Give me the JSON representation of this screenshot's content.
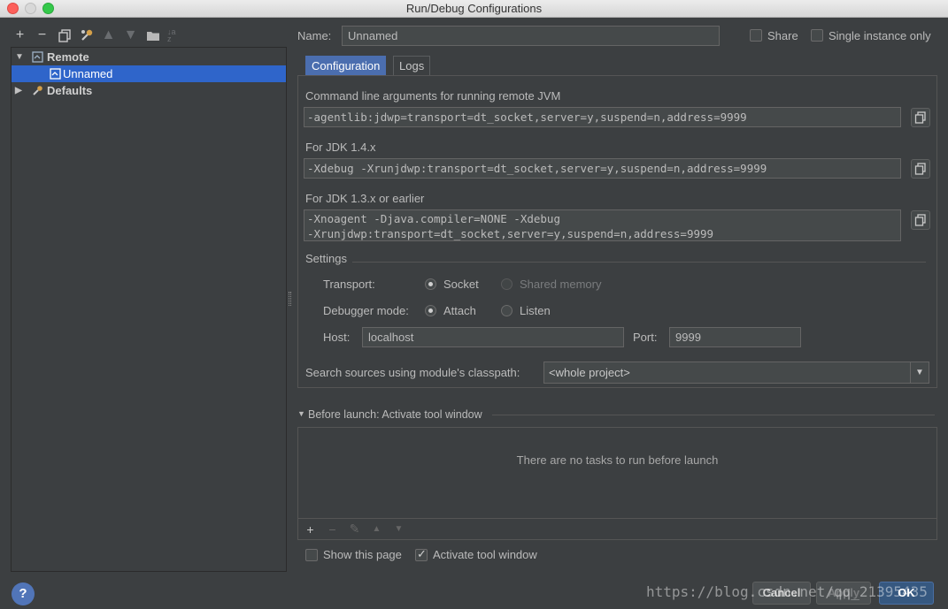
{
  "window": {
    "title": "Run/Debug Configurations"
  },
  "toolbar": {
    "icons": [
      "add-icon",
      "remove-icon",
      "copy-icon",
      "wrench-icon",
      "arrow-up-icon",
      "arrow-down-icon",
      "folder-icon",
      "sort-icon"
    ],
    "sort_glyph": "↓a z"
  },
  "tree": {
    "items": [
      {
        "label": "Remote",
        "expanded": true
      },
      {
        "label": "Unnamed",
        "selected": true
      },
      {
        "label": "Defaults",
        "expanded": false
      }
    ]
  },
  "header": {
    "name_label": "Name:",
    "name_value": "Unnamed",
    "share_label": "Share",
    "single_instance_label": "Single instance only"
  },
  "tabs": [
    {
      "label": "Configuration",
      "active": true
    },
    {
      "label": "Logs",
      "active": false
    }
  ],
  "config": {
    "cmd_label": "Command line arguments for running remote JVM",
    "cmd_value": "-agentlib:jdwp=transport=dt_socket,server=y,suspend=n,address=9999",
    "jdk14_label": "For JDK 1.4.x",
    "jdk14_value": "-Xdebug -Xrunjdwp:transport=dt_socket,server=y,suspend=n,address=9999",
    "jdk13_label": "For JDK 1.3.x or earlier",
    "jdk13_value": "-Xnoagent -Djava.compiler=NONE -Xdebug\n-Xrunjdwp:transport=dt_socket,server=y,suspend=n,address=9999",
    "settings_label": "Settings",
    "transport_label": "Transport:",
    "transport_options": [
      "Socket",
      "Shared memory"
    ],
    "debugger_mode_label": "Debugger mode:",
    "debugger_mode_options": [
      "Attach",
      "Listen"
    ],
    "host_label": "Host:",
    "host_value": "localhost",
    "port_label": "Port:",
    "port_value": "9999",
    "classpath_label": "Search sources using module's classpath:",
    "classpath_value": "<whole project>"
  },
  "before_launch": {
    "title": "Before launch: Activate tool window",
    "empty_text": "There are no tasks to run before launch",
    "toolbar_icons": [
      "add-icon",
      "remove-icon",
      "edit-icon",
      "arrow-up-icon",
      "arrow-down-icon"
    ]
  },
  "footer": {
    "show_page_label": "Show this page",
    "activate_tool_label": "Activate tool window",
    "cancel_label": "Cancel",
    "apply_label": "Apply",
    "ok_label": "OK",
    "help_label": "?",
    "watermark": "https://blog.csdn.net/qq_21395435"
  },
  "colors": {
    "background": "#3c3f41",
    "selection": "#2f65ca",
    "active_tab": "#4b6eaf",
    "field": "#45494a"
  }
}
